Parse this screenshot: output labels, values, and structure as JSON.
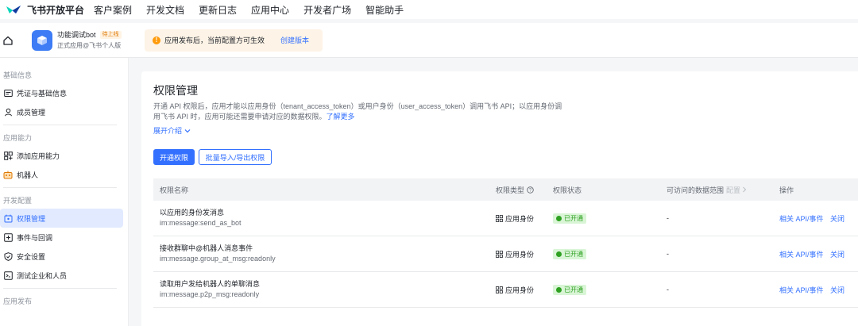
{
  "brand": {
    "name": "飞书开放平台"
  },
  "topnav": [
    "客户案例",
    "开发文档",
    "更新日志",
    "应用中心",
    "开发者广场",
    "智能助手"
  ],
  "app": {
    "name": "功能调试bot",
    "badge": "待上线",
    "subtitle": "正式应用@飞书个人版",
    "notice": "应用发布后，当前配置方可生效",
    "notice_icon": "!",
    "notice_action": "创建版本"
  },
  "sidebar": {
    "sections": [
      {
        "title": "基础信息",
        "items": [
          {
            "label": "凭证与基础信息",
            "icon": "credential-icon"
          },
          {
            "label": "成员管理",
            "icon": "person-icon"
          }
        ]
      },
      {
        "title": "应用能力",
        "items": [
          {
            "label": "添加应用能力",
            "icon": "grid-add-icon"
          },
          {
            "label": "机器人",
            "icon": "robot-icon"
          }
        ]
      },
      {
        "title": "开发配置",
        "items": [
          {
            "label": "权限管理",
            "icon": "lock-icon",
            "active": true
          },
          {
            "label": "事件与回调",
            "icon": "event-icon"
          },
          {
            "label": "安全设置",
            "icon": "shield-icon"
          },
          {
            "label": "测试企业和人员",
            "icon": "test-icon"
          }
        ]
      },
      {
        "title": "应用发布",
        "items": []
      }
    ]
  },
  "main": {
    "title": "权限管理",
    "desc_line1": "开通 API 权限后，应用才能以应用身份（tenant_access_token）或用户身份（user_access_token）调用飞书 API；以应用身份调",
    "desc_line2": "用飞书 API 时，应用可能还需要申请对应的数据权限。",
    "desc_more": "了解更多",
    "expand": "展开介绍",
    "btn_open": "开通权限",
    "btn_batch": "批量导入/导出权限"
  },
  "table": {
    "headers": {
      "name": "权限名称",
      "type": "权限类型",
      "status": "权限状态",
      "scope": "可访问的数据范围",
      "scope_config": "配置",
      "ops": "操作"
    },
    "rows": [
      {
        "title": "以应用的身份发消息",
        "code": "im:message:send_as_bot",
        "type": "应用身份",
        "status": "已开通",
        "scope": "-",
        "op1": "相关 API/事件",
        "op2": "关闭"
      },
      {
        "title": "接收群聊中@机器人消息事件",
        "code": "im:message.group_at_msg:readonly",
        "type": "应用身份",
        "status": "已开通",
        "scope": "-",
        "op1": "相关 API/事件",
        "op2": "关闭"
      },
      {
        "title": "读取用户发给机器人的单聊消息",
        "code": "im:message.p2p_msg:readonly",
        "type": "应用身份",
        "status": "已开通",
        "scope": "-",
        "op1": "相关 API/事件",
        "op2": "关闭"
      }
    ]
  },
  "colors": {
    "accent": "#3370ff",
    "success": "#2ea121",
    "warning": "#ff9a0a"
  }
}
